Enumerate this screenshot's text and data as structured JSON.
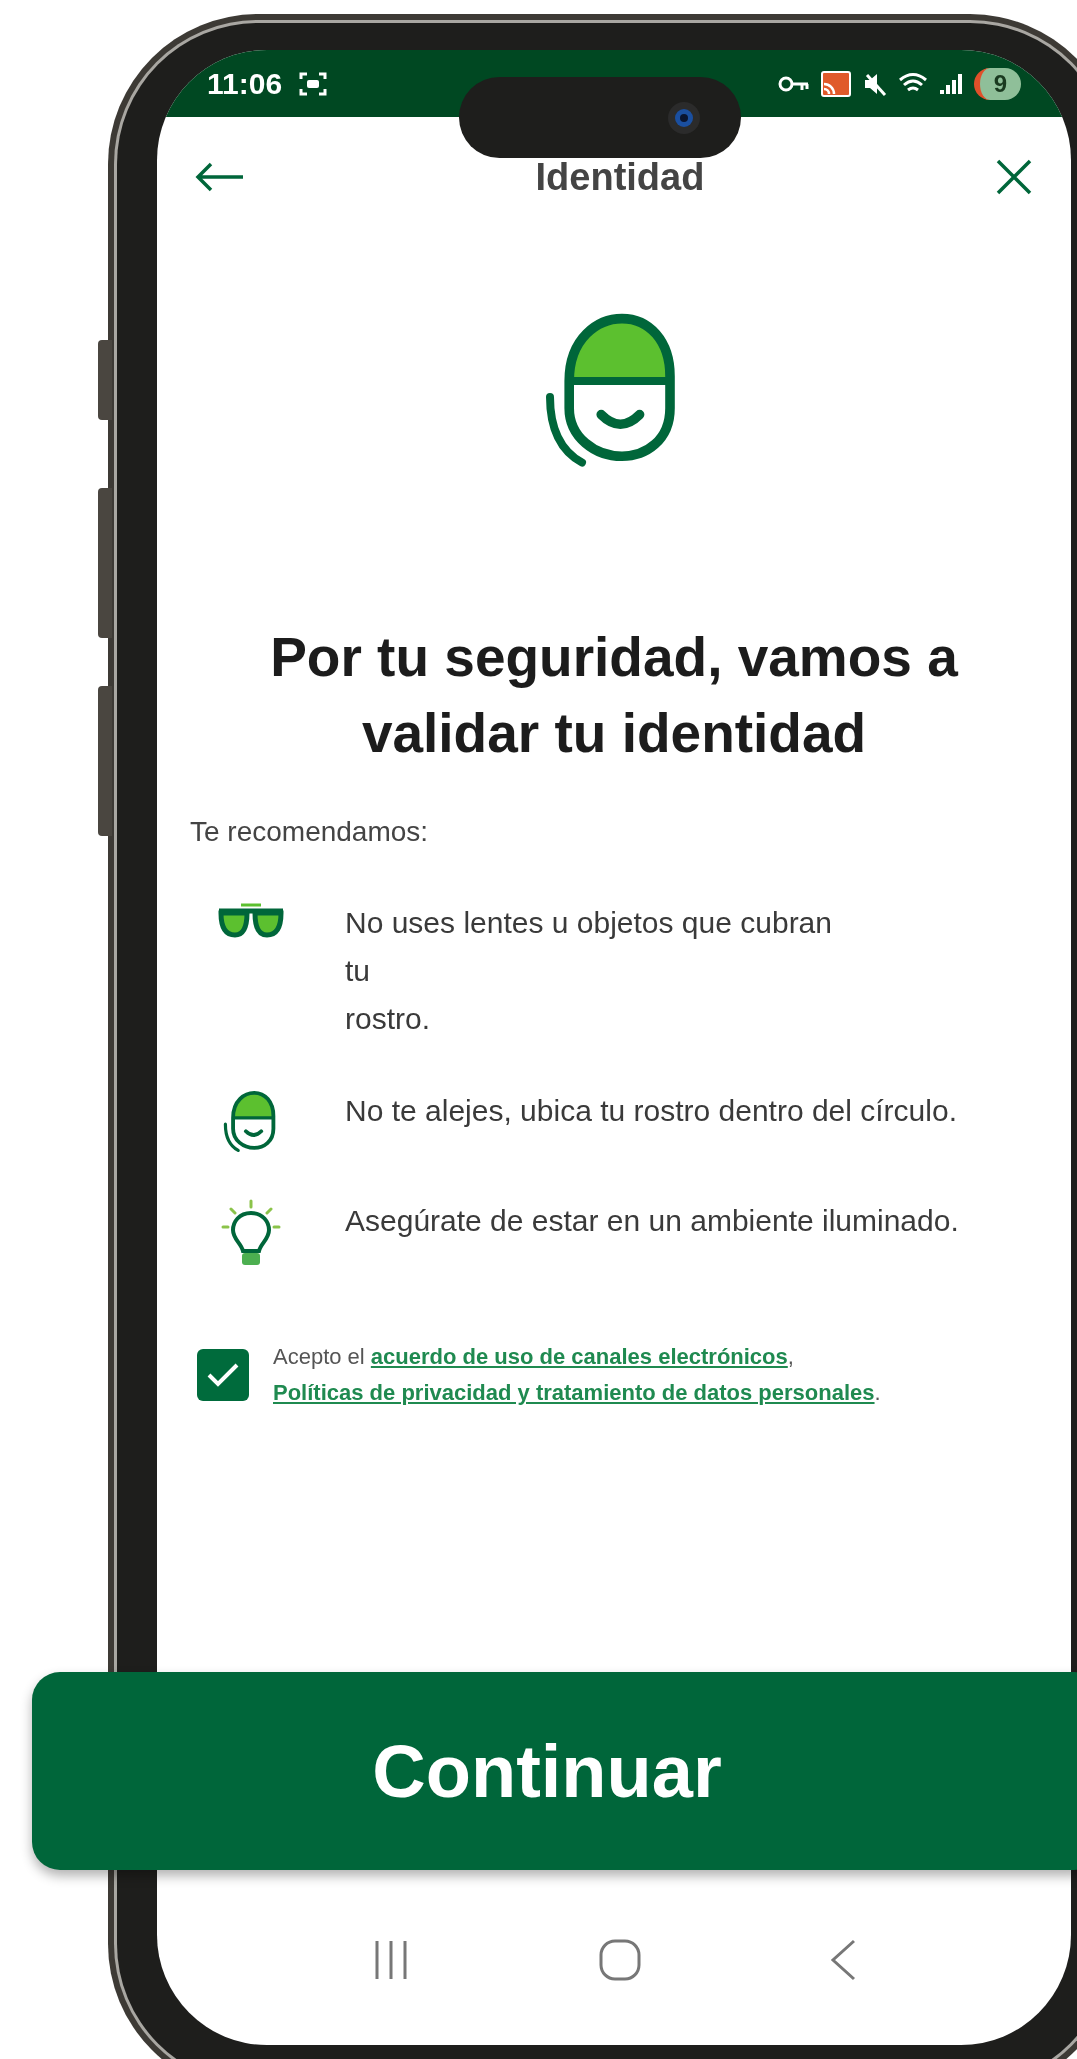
{
  "status_bar": {
    "time": "11:06",
    "battery": "9"
  },
  "header": {
    "title": "Identidad"
  },
  "heading": "Por tu seguridad, vamos a validar tu identidad",
  "recommend_label": "Te recomendamos:",
  "tips": [
    {
      "kind": "glasses",
      "text": "No uses lentes u objetos que cubran\ntu\nrostro."
    },
    {
      "kind": "face",
      "text": "No te alejes, ubica tu rostro dentro del círculo."
    },
    {
      "kind": "bulb",
      "text": "Asegúrate de estar en un ambiente iluminado."
    }
  ],
  "consent": {
    "checked": true,
    "parts": [
      {
        "kind": "text",
        "text": "Acepto el "
      },
      {
        "kind": "link",
        "text": "acuerdo de uso de canales electrónicos"
      },
      {
        "kind": "text",
        "text": ", "
      },
      {
        "kind": "link",
        "text": "Políticas de privacidad y tratamiento de datos personales"
      },
      {
        "kind": "text",
        "text": "."
      }
    ]
  },
  "button": {
    "label": "Continuar"
  }
}
